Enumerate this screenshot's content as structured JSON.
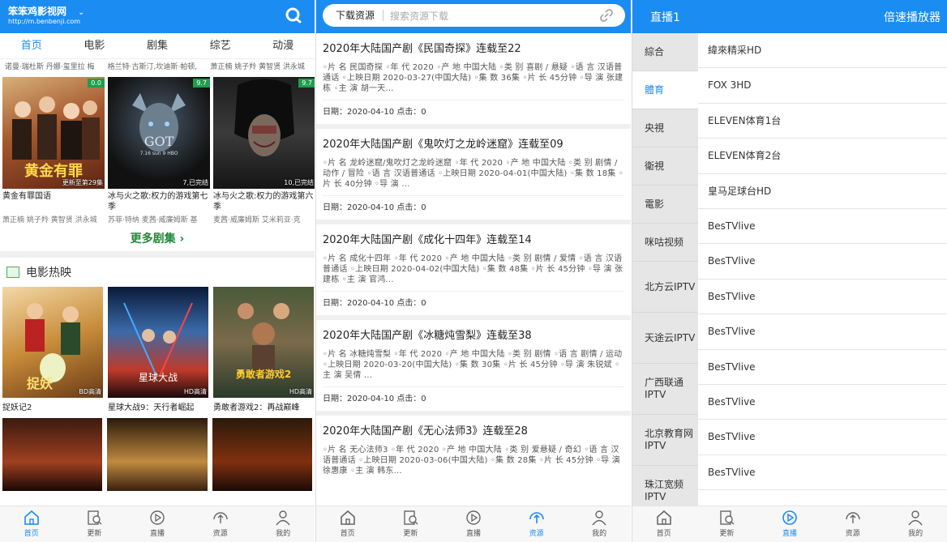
{
  "panel_home": {
    "site_name": "笨笨鸡影视网",
    "site_url": "http://m.benbenji.com",
    "tabs": [
      "首页",
      "电影",
      "剧集",
      "综艺",
      "动漫"
    ],
    "casts": [
      "诺曼·瑞杜斯 丹娜·玺里拉 梅",
      "格兰特·古斯汀,坎迪斯·帕顿,",
      "萧正楠 姚子羚 黄智贤 洪永城"
    ],
    "series_cards": [
      {
        "title": "黄金有罪国语",
        "cast": "萧正楠 姚子羚 黄智贤 洪永城",
        "score": "0.0",
        "ribbon": "更新至第29集"
      },
      {
        "title": "冰与火之歌:权力的游戏第七季",
        "cast": "苏菲·特纳 麦茜·威廉姆斯 基",
        "score": "9.7",
        "ribbon": "7,已完结"
      },
      {
        "title": "冰与火之歌:权力的游戏第六季",
        "cast": "麦茜·威廉姆斯 艾米莉亚·克",
        "score": "9.7",
        "ribbon": "10,已完结"
      }
    ],
    "more_label": "更多剧集 ›",
    "section_title": "电影热映",
    "movie_cards": [
      {
        "title": "捉妖记2",
        "badge": "BD高清"
      },
      {
        "title": "星球大战9：天行者崛起",
        "badge": "HD高清"
      },
      {
        "title": "勇敢者游戏2：再战巅峰",
        "badge": "HD高清"
      }
    ]
  },
  "panel_news": {
    "pill_label": "下载资源",
    "search_placeholder": "搜索资源下载",
    "items": [
      {
        "title": "2020年大陆国产剧《民国奇探》连载至22",
        "desc": "◦片 名 民国奇探 ◦年 代 2020 ◦产 地 中国大陆 ◦类 别 喜剧 / 悬疑 ◦语 言 汉语普通话 ◦上映日期 2020-03-27(中国大陆) ◦集 数 36集 ◦片 长 45分钟 ◦导 演 张建栋 ◦主 演 胡一天...",
        "meta": "日期：2020-04-10 点击：0"
      },
      {
        "title": "2020年大陆国产剧《鬼吹灯之龙岭迷窟》连载至09",
        "desc": "◦片 名 龙岭迷窟/鬼吹灯之龙岭迷窟 ◦年 代 2020 ◦产 地 中国大陆 ◦类 别 剧情 / 动作 / 冒险 ◦语 言 汉语普通话 ◦上映日期 2020-04-01(中国大陆) ◦集 数 18集 ◦片 长 40分钟 ◦导 演 ...",
        "meta": "日期：2020-04-10 点击：0"
      },
      {
        "title": "2020年大陆国产剧《成化十四年》连载至14",
        "desc": "◦片 名 成化十四年 ◦年 代 2020 ◦产 地 中国大陆 ◦类 别 剧情 / 爱情 ◦语 言 汉语普通话 ◦上映日期 2020-04-02(中国大陆) ◦集 数 48集 ◦片 长 45分钟 ◦导 演 张建栋 ◦主 演 官鸿...",
        "meta": "日期：2020-04-10 点击：0"
      },
      {
        "title": "2020年大陆国产剧《冰糖炖雪梨》连载至38",
        "desc": "◦片 名 冰糖炖雪梨 ◦年 代 2020 ◦产 地 中国大陆 ◦类 别 剧情 ◦语 言 剧情 / 运动 ◦上映日期 2020-03-20(中国大陆) ◦集 数 30集 ◦片 长 45分钟 ◦导 演 朱锐斌 ◦主 演 吴倩 ...",
        "meta": "日期：2020-04-10 点击：0"
      },
      {
        "title": "2020年大陆国产剧《无心法师3》连载至28",
        "desc": "◦片 名 无心法师3 ◦年 代 2020 ◦产 地 中国大陆 ◦类 别 爱悬疑 / 奇幻 ◦语 言 汉语普通话 ◦上映日期 2020-03-06(中国大陆) ◦集 数 28集 ◦片 长 45分钟 ◦导 演 徐惠康 ◦主 演 韩东...",
        "meta": ""
      }
    ]
  },
  "panel_live": {
    "title": "直播1",
    "right_label": "倍速播放器",
    "categories": [
      "綜合",
      "體育",
      "央視",
      "衛視",
      "電影",
      "咪咕视频",
      "北方云IPTV",
      "天途云IPTV",
      "广西联通IPTV",
      "北京教育网IPTV",
      "珠江宽频IPTV"
    ],
    "channels": [
      "緯來精采HD",
      "FOX 3HD",
      "ELEVEN体育1台",
      "ELEVEN体育2台",
      "皇马足球台HD",
      "BesTVlive",
      "BesTVlive",
      "BesTVlive",
      "BesTVlive",
      "BesTVlive",
      "BesTVlive",
      "BesTVlive",
      "BesTVlive"
    ]
  },
  "bottom_nav": {
    "labels": [
      "首页",
      "更新",
      "直播",
      "资源",
      "我的"
    ],
    "active_colors": {
      "accent": "#1a8cf2"
    }
  }
}
